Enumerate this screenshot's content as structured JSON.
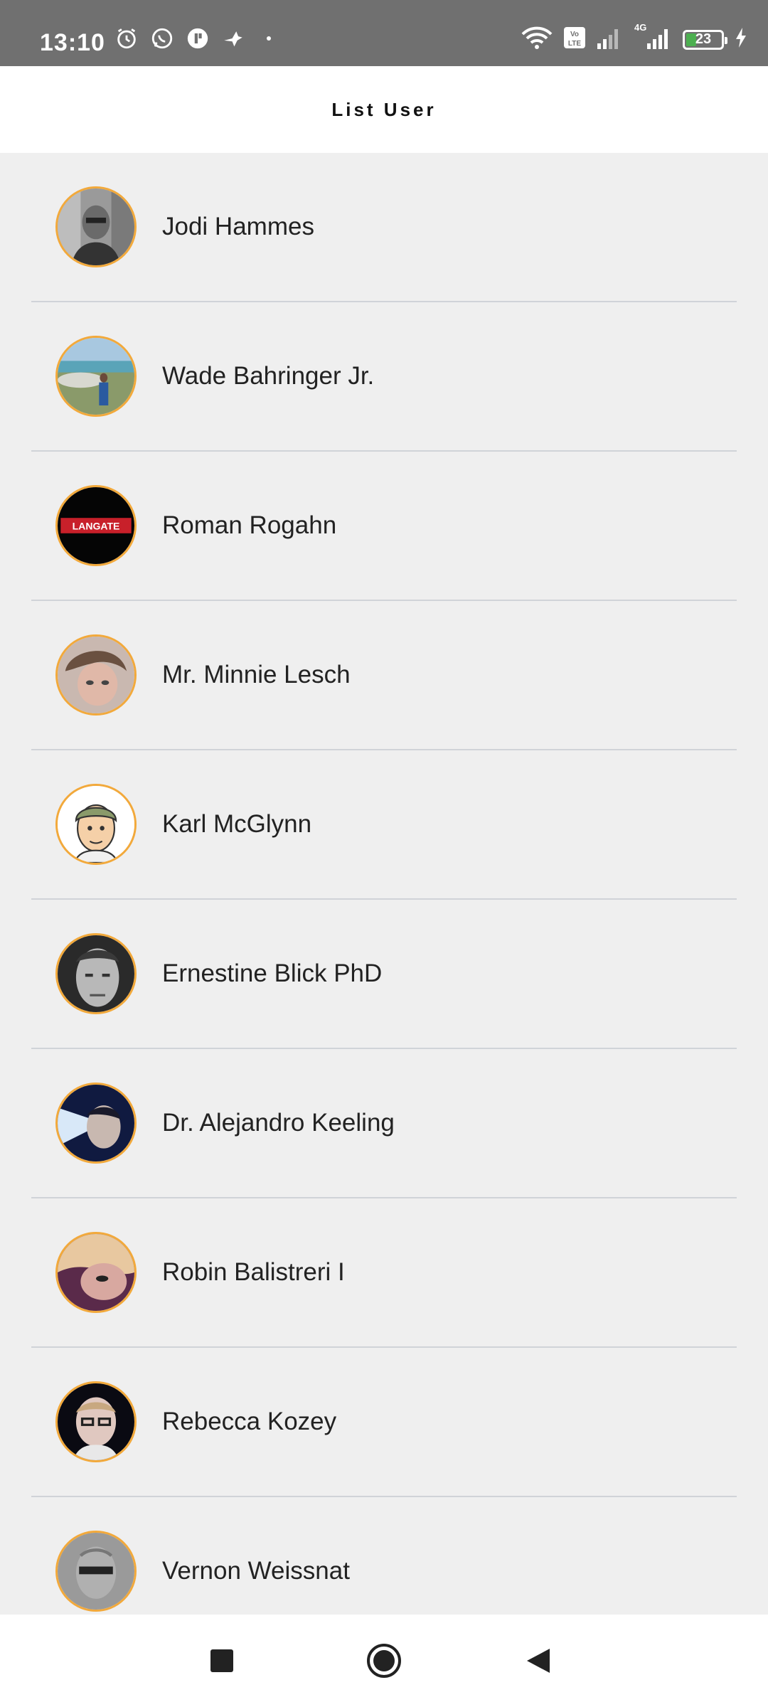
{
  "status_bar": {
    "time": "13:10",
    "battery": "23",
    "network": "4G"
  },
  "header": {
    "title": "List User"
  },
  "users": [
    {
      "name": "Jodi Hammes"
    },
    {
      "name": "Wade Bahringer Jr."
    },
    {
      "name": "Roman Rogahn",
      "avatar_text": "LANGATE"
    },
    {
      "name": "Mr. Minnie Lesch"
    },
    {
      "name": "Karl McGlynn"
    },
    {
      "name": "Ernestine Blick PhD"
    },
    {
      "name": "Dr. Alejandro Keeling"
    },
    {
      "name": "Robin Balistreri I"
    },
    {
      "name": "Rebecca Kozey"
    },
    {
      "name": "Vernon Weissnat"
    }
  ],
  "colors": {
    "status_bar": "#707070",
    "avatar_border": "#f2a93b",
    "list_background": "#efefef",
    "divider": "#d0d3d8"
  }
}
